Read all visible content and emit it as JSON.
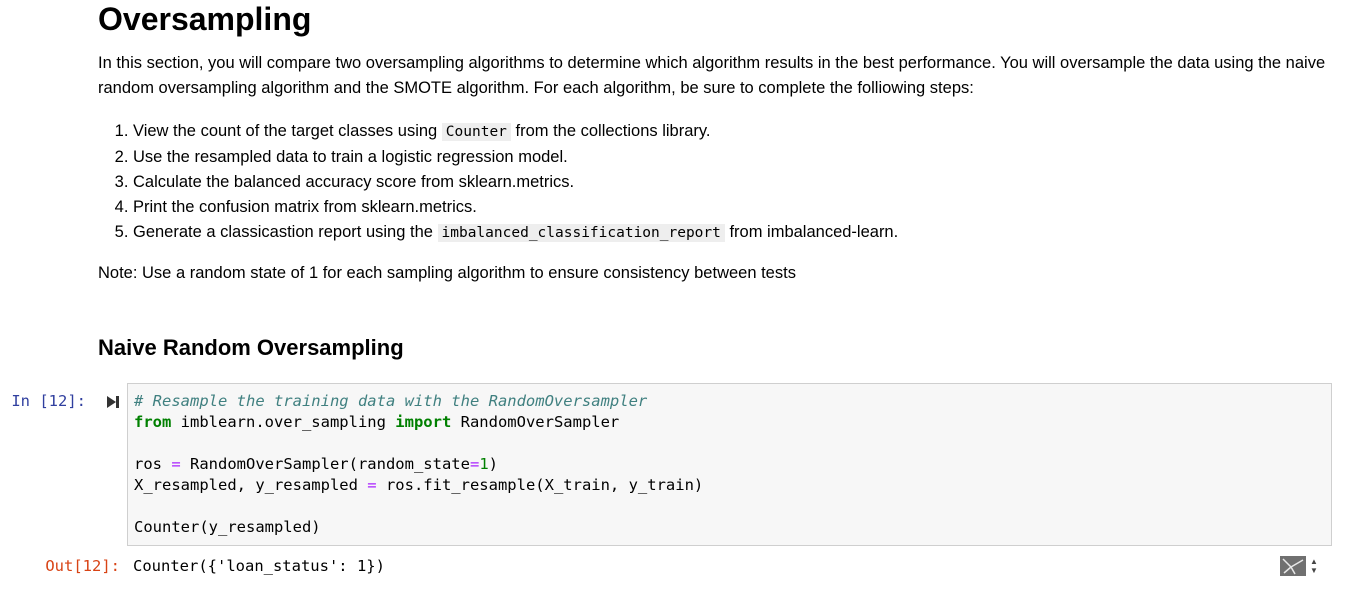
{
  "heading": "Oversampling",
  "intro": "In this section, you will compare two oversampling algorithms to determine which algorithm results in the best performance. You will oversample the data using the naive random oversampling algorithm and the SMOTE algorithm. For each algorithm, be sure to complete the folliowing steps:",
  "steps": [
    {
      "before": "View the count of the target classes using ",
      "code": "Counter",
      "after": " from the collections library."
    },
    {
      "text": "Use the resampled data to train a logistic regression model."
    },
    {
      "text": "Calculate the balanced accuracy score from sklearn.metrics."
    },
    {
      "text": "Print the confusion matrix from sklearn.metrics."
    },
    {
      "before": "Generate a classicastion report using the ",
      "code": "imbalanced_classification_report",
      "after": " from imbalanced-learn."
    }
  ],
  "note": "Note: Use a random state of 1 for each sampling algorithm to ensure consistency between tests",
  "subheading": "Naive Random Oversampling",
  "cell": {
    "in_prompt": "In [12]:",
    "out_prompt": "Out[12]:",
    "code": {
      "comment": "# Resample the training data with the RandomOversampler",
      "from_kw": "from",
      "module": " imblearn.over_sampling ",
      "import_kw": "import",
      "import_name": " RandomOverSampler",
      "ros_var": "ros ",
      "eq1": "=",
      "ros_call": " RandomOverSampler(random_state",
      "eq2": "=",
      "one": "1",
      "close_paren": ")",
      "xy_vars": "X_resampled, y_resampled ",
      "eq3": "=",
      "fit_call": " ros.fit_resample(X_train, y_train)",
      "counter_call": "Counter(y_resampled)"
    },
    "output": "Counter({'loan_status': 1})"
  },
  "icons": {
    "run": "step-forward-icon",
    "output_toggle": "output-scroll-icon"
  }
}
